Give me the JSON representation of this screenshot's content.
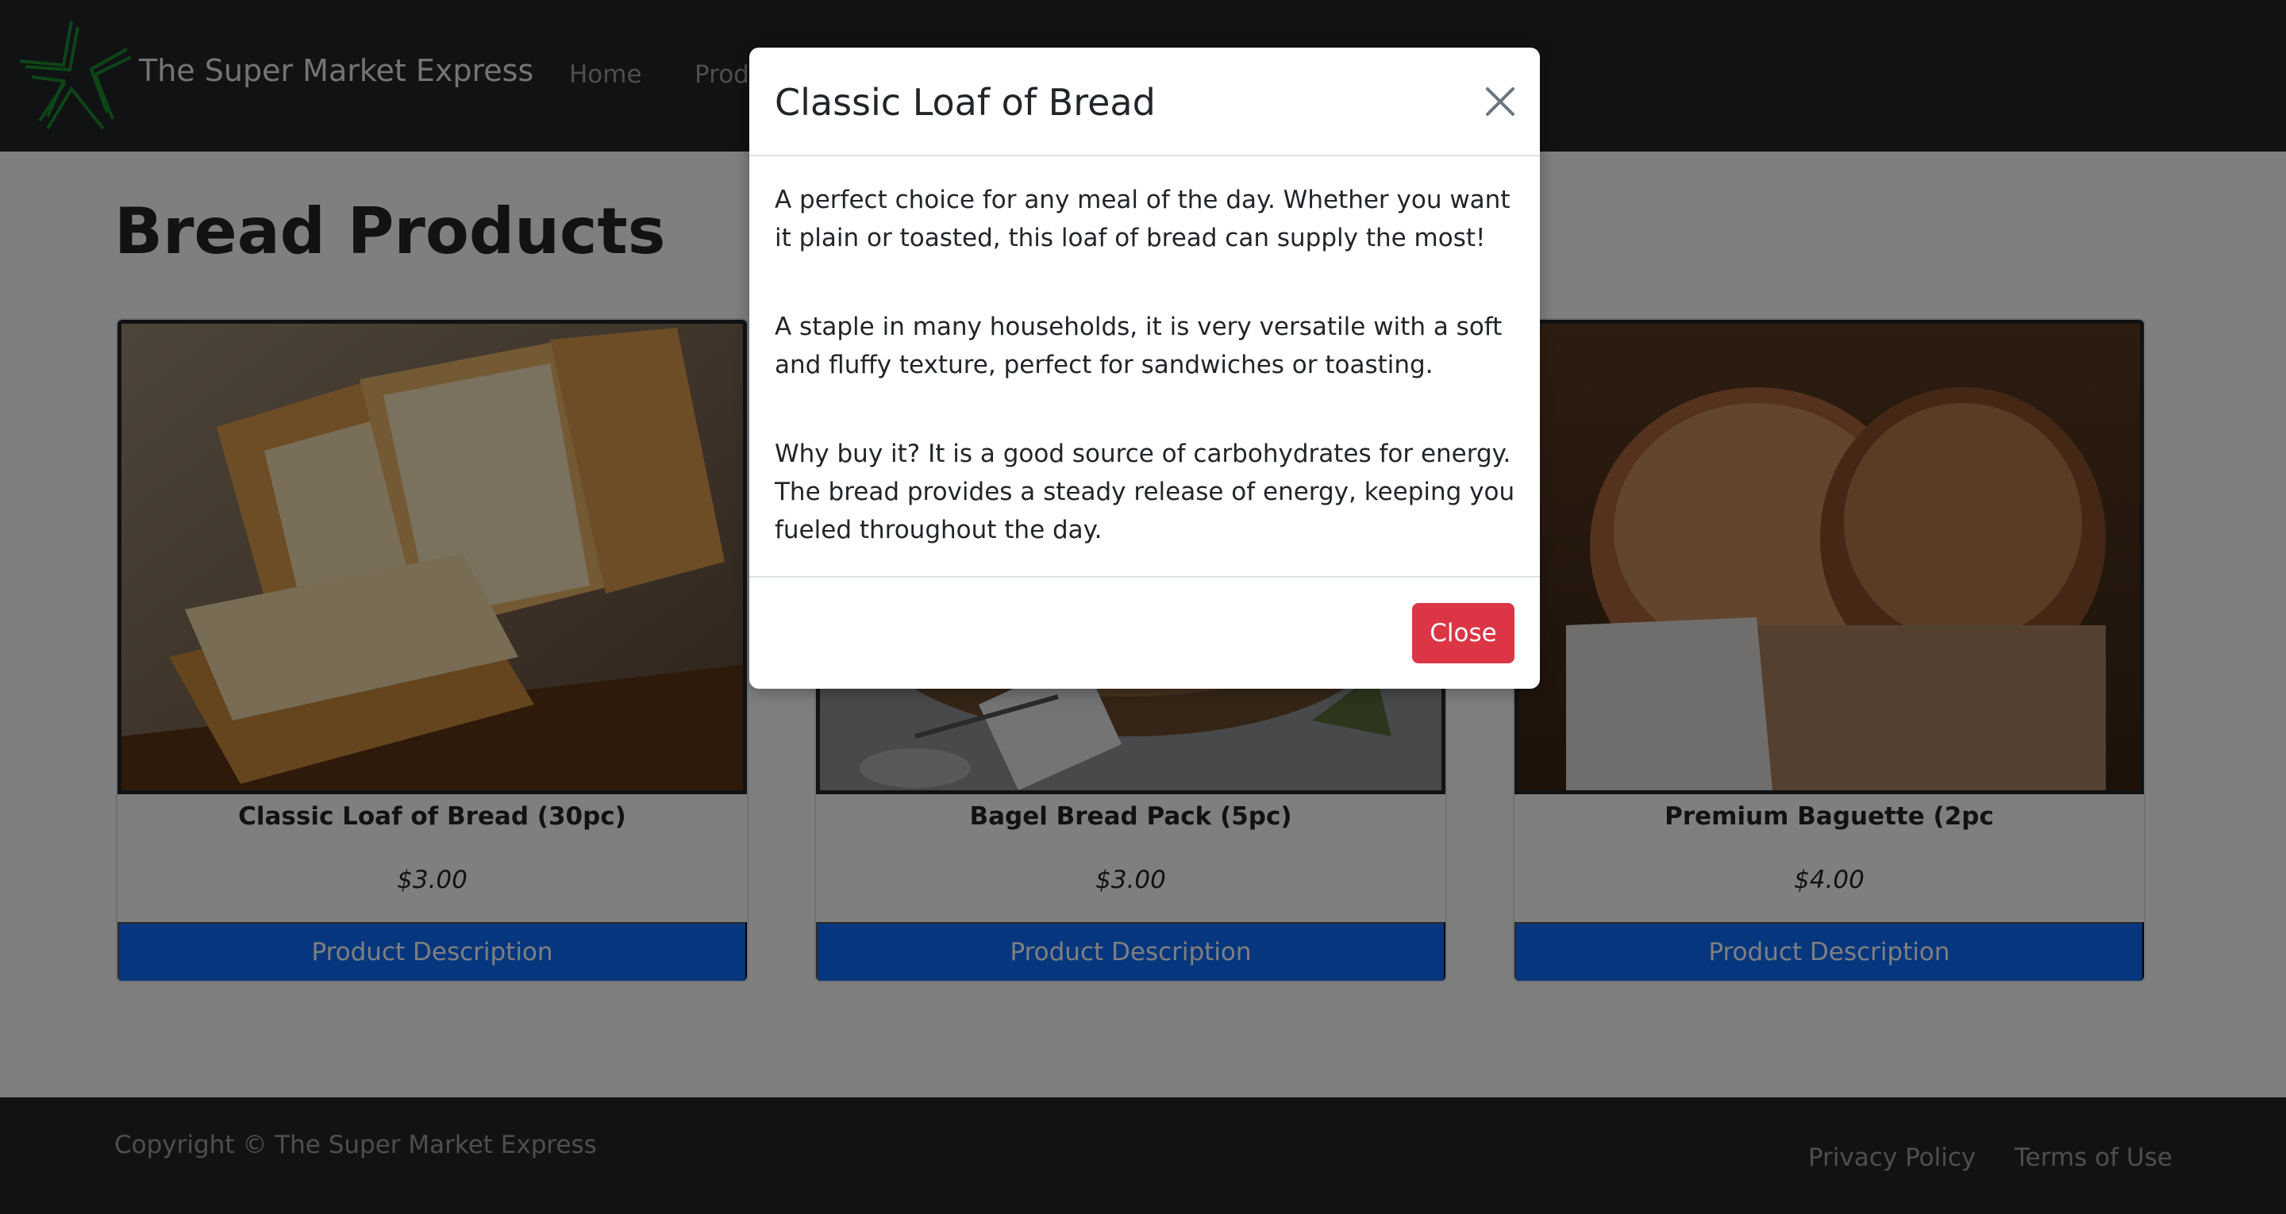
{
  "navbar": {
    "brand": "The Super Market Express",
    "links": [
      {
        "label": "Home"
      },
      {
        "label": "Prod"
      }
    ]
  },
  "main": {
    "title": "Bread Products",
    "products": [
      {
        "name": "Classic Loaf of Bread (30pc)",
        "price": "$3.00",
        "button": "Product Description"
      },
      {
        "name": "Bagel Bread Pack (5pc)",
        "price": "$3.00",
        "button": "Product Description"
      },
      {
        "name": "Premium Baguette (2pc",
        "price": "$4.00",
        "button": "Product Description"
      }
    ]
  },
  "footer": {
    "copyright": "Copyright © The Super Market Express",
    "privacy": "Privacy Policy",
    "terms": "Terms of Use"
  },
  "modal": {
    "title": "Classic Loaf of Bread",
    "paragraphs": [
      "A perfect choice for any meal of the day. Whether you want it plain or toasted, this loaf of bread can supply the most!",
      "A staple in many households, it is very versatile with a soft and fluffy texture, perfect for sandwiches or toasting.",
      "Why buy it? It is a good source of carbohydrates for energy. The bread provides a steady release of energy, keeping you fueled throughout the day."
    ],
    "close_label": "Close"
  },
  "colors": {
    "navbar": "#212529",
    "primary": "#0d6efd",
    "danger": "#dc3545",
    "logo": "#1a8a2e"
  }
}
